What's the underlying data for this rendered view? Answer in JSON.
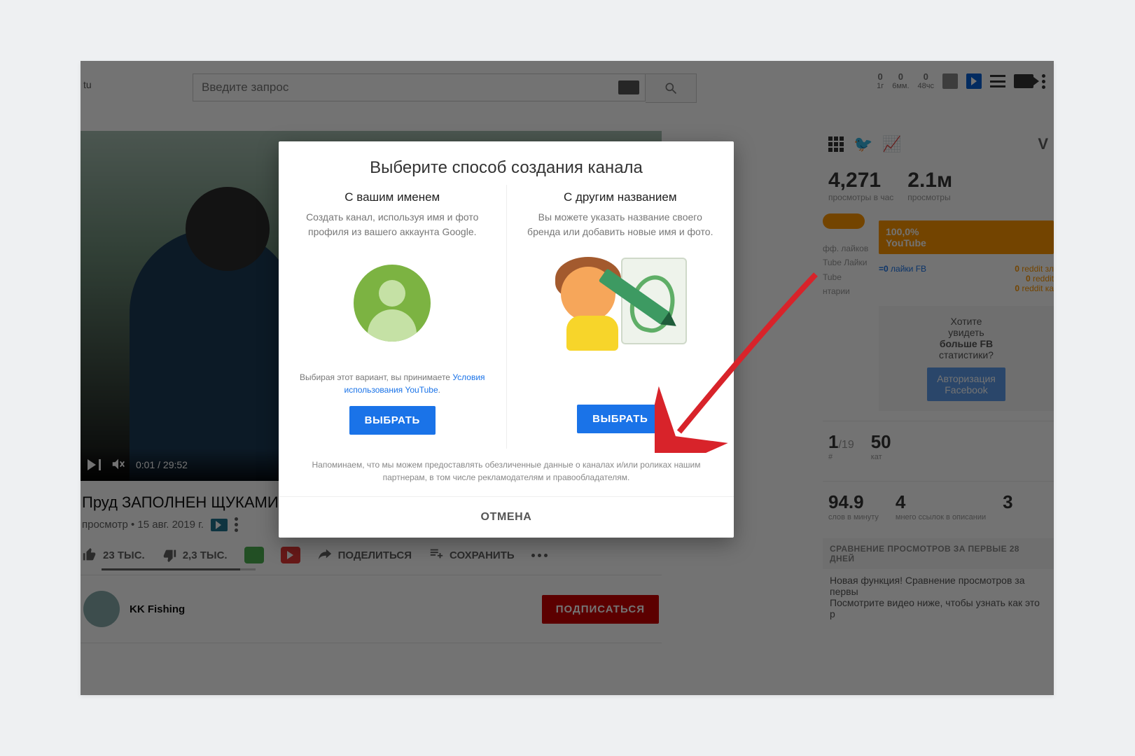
{
  "topbar": {
    "loc_fragment": "tu",
    "search_placeholder": "Введите запрос",
    "stats": [
      {
        "n": "0",
        "l": "1г"
      },
      {
        "n": "0",
        "l": "6мм."
      },
      {
        "n": "0",
        "l": "48чс"
      }
    ]
  },
  "video": {
    "time": "0:01 / 29:52",
    "title": "Пруд ЗАПОЛНЕН ЩУКАМИ!!! (Ры",
    "meta": "просмотр • 15 авг. 2019 г.",
    "likes": "23 ТЫС.",
    "dislikes": "2,3 ТЫС.",
    "share": "ПОДЕЛИТЬСЯ",
    "save": "СОХРАНИТЬ",
    "channel": "KK Fishing",
    "subscribe": "ПОДПИСАТЬСЯ"
  },
  "sidebar": {
    "big_stats": [
      {
        "n": "4,271",
        "l": "просмотры в час"
      },
      {
        "n": "2.1м",
        "l": "просмотры"
      }
    ],
    "orange_source": "100,0%",
    "orange_source_label": "YouTube",
    "extra_lines": [
      "фф. лайков",
      "Tube Лайки",
      "Tube",
      "нтарии"
    ],
    "fb_like_label": "лайки FB",
    "fb_like_val": "=0",
    "reddit_lines": [
      "reddit зл",
      "reddit",
      "reddit ка"
    ],
    "reddit_zero": "0",
    "fb_prompt_l1": "Хотите",
    "fb_prompt_l2": "увидеть",
    "fb_prompt_l3": "больше FB",
    "fb_prompt_l4": "статистики?",
    "fb_btn_l1": "Авторизация",
    "fb_btn_l2": "Facebook",
    "mid_stats": [
      {
        "n": "1",
        "s": "/19",
        "l": "#"
      },
      {
        "n": "50",
        "l": "кат"
      }
    ],
    "low_stats": [
      {
        "n": "94.9",
        "l": "слов в минуту"
      },
      {
        "n": "4",
        "l": "мнего ссылок в описании"
      },
      {
        "n": "3",
        "l": ""
      }
    ],
    "compare_head": "СРАВНЕНИЕ ПРОСМОТРОВ ЗА ПЕРВЫЕ 28 ДНЕЙ",
    "compare_l1": "Новая функция! Сравнение просмотров за первы",
    "compare_l2": "Посмотрите видео ниже, чтобы узнать как это р"
  },
  "modal": {
    "title": "Выберите способ создания канала",
    "left": {
      "heading": "С вашим именем",
      "desc": "Создать канал, используя имя и фото профиля из вашего аккаунта Google.",
      "note_pre": "Выбирая этот вариант, вы принимаете ",
      "note_link": "Условия использования YouTube",
      "note_post": ".",
      "button": "ВЫБРАТЬ"
    },
    "right": {
      "heading": "С другим названием",
      "desc": "Вы можете указать название своего бренда или добавить новые имя и фото.",
      "button": "ВЫБРАТЬ"
    },
    "footnote": "Напоминаем, что мы можем предоставлять обезличенные данные о каналах и/или роликах нашим партнерам, в том числе рекламодателям и правообладателям.",
    "cancel": "ОТМЕНА"
  }
}
